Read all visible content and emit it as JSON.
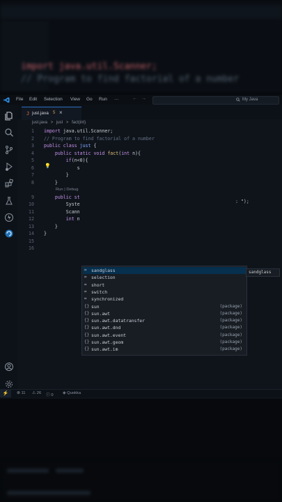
{
  "background_blur": {
    "top_lines": [
      "import java.util.Scanner;",
      "// Program to find factorial of a number"
    ]
  },
  "titlebar": {
    "menus": [
      "File",
      "Edit",
      "Selection",
      "View",
      "Go",
      "Run"
    ],
    "more": "···",
    "nav_back": "←",
    "nav_forward": "→",
    "search_icon": "search-icon",
    "search_text": "My Java"
  },
  "activity_bar": {
    "top": [
      "files-icon",
      "search-icon",
      "source-control-icon",
      "run-debug-icon",
      "extensions-icon",
      "testing-icon",
      "quokka-icon",
      "remote-explorer-icon"
    ],
    "bottom": [
      "account-icon",
      "settings-gear-icon"
    ]
  },
  "tab": {
    "icon": "J",
    "name": "just.java",
    "modified": "5",
    "close": "×"
  },
  "breadcrumbs": [
    "just.java",
    ">",
    "just",
    ">",
    "fact(int)"
  ],
  "editor": {
    "line_numbers": [
      "1",
      "2",
      "3",
      "4",
      "5",
      "6",
      "7",
      "8",
      "9",
      "10",
      "11",
      "12",
      "13",
      "14",
      "15",
      "16"
    ],
    "codelens": "Run | Debug",
    "ghost_text": ": \");"
  },
  "suggestions": {
    "items": [
      {
        "icon": "keyword-icon",
        "label": "sandglass",
        "detail": ""
      },
      {
        "icon": "keyword-icon",
        "label": "selection",
        "detail": ""
      },
      {
        "icon": "keyword-icon",
        "label": "short",
        "detail": ""
      },
      {
        "icon": "keyword-icon",
        "label": "switch",
        "detail": ""
      },
      {
        "icon": "keyword-icon",
        "label": "synchronized",
        "detail": ""
      },
      {
        "icon": "module-icon",
        "label": "sun",
        "detail": "(package)"
      },
      {
        "icon": "module-icon",
        "label": "sun.awt",
        "detail": "(package)"
      },
      {
        "icon": "module-icon",
        "label": "sun.awt.datatransfer",
        "detail": "(package)"
      },
      {
        "icon": "module-icon",
        "label": "sun.awt.dnd",
        "detail": "(package)"
      },
      {
        "icon": "module-icon",
        "label": "sun.awt.event",
        "detail": "(package)"
      },
      {
        "icon": "module-icon",
        "label": "sun.awt.geom",
        "detail": "(package)"
      },
      {
        "icon": "module-icon",
        "label": "sun.awt.im",
        "detail": "(package)"
      }
    ],
    "selected_detail": "sandglass"
  },
  "statusbar": {
    "remote": "⚡",
    "errors": "⊗ 11",
    "warnings": "⚠ 26",
    "info": "ⓘ 0",
    "extension": "Quokka"
  },
  "colors": {
    "accent": "#2a6fc0",
    "selection": "#06304e"
  }
}
